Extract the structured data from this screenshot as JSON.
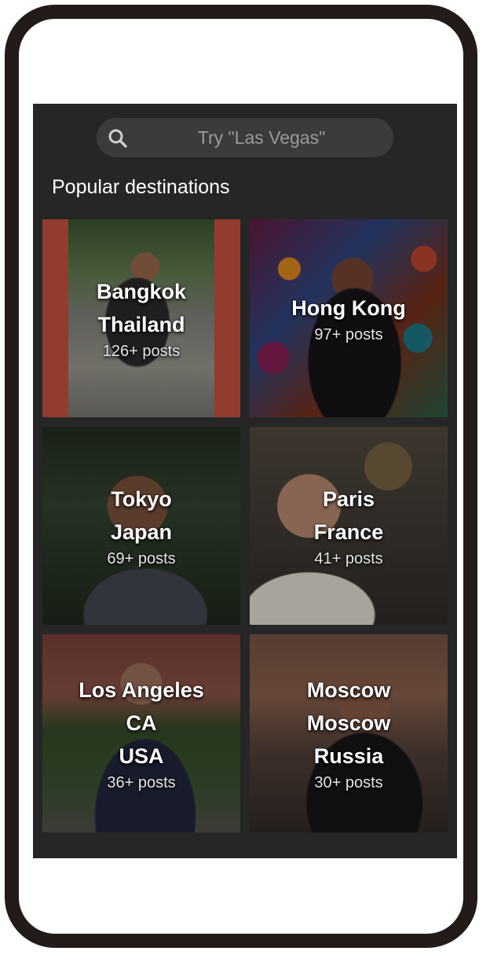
{
  "search": {
    "placeholder": "Try \"Las Vegas\""
  },
  "section_title": "Popular destinations",
  "destinations": [
    {
      "name": "Bangkok\nThailand",
      "posts": "126+ posts"
    },
    {
      "name": "Hong Kong",
      "posts": "97+ posts"
    },
    {
      "name": "Tokyo\nJapan",
      "posts": "69+ posts"
    },
    {
      "name": "Paris\nFrance",
      "posts": "41+ posts"
    },
    {
      "name": "Los Angeles\nCA\nUSA",
      "posts": "36+ posts"
    },
    {
      "name": "Moscow\nMoscow\nRussia",
      "posts": "30+ posts"
    }
  ],
  "icons": {
    "search": "search-icon"
  },
  "colors": {
    "frame": "#231a1a",
    "screen_bg": "#262626",
    "search_bg": "#3b3b3b",
    "placeholder_text": "#9a9a9a",
    "text": "#ffffff"
  }
}
